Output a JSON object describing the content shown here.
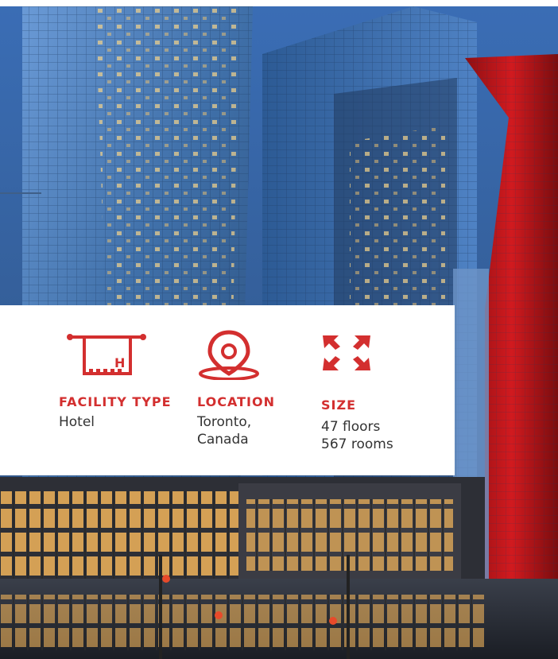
{
  "colors": {
    "accent_red": "#d32f2f",
    "text_dark": "#333333",
    "panel_bg": "#ffffff",
    "sky_blue": "#3b72b8"
  },
  "background": {
    "icon_name": "hotel-building-photo"
  },
  "info_panel": {
    "facility_type": {
      "icon": "towel-hotel-icon",
      "label": "FACILITY TYPE",
      "value": "Hotel"
    },
    "location": {
      "icon": "location-pin-icon",
      "label": "LOCATION",
      "value_line1": "Toronto,",
      "value_line2": "Canada"
    },
    "size": {
      "icon": "expand-arrows-icon",
      "label": "SIZE",
      "value_line1": "47 floors",
      "value_line2": "567 rooms"
    }
  }
}
